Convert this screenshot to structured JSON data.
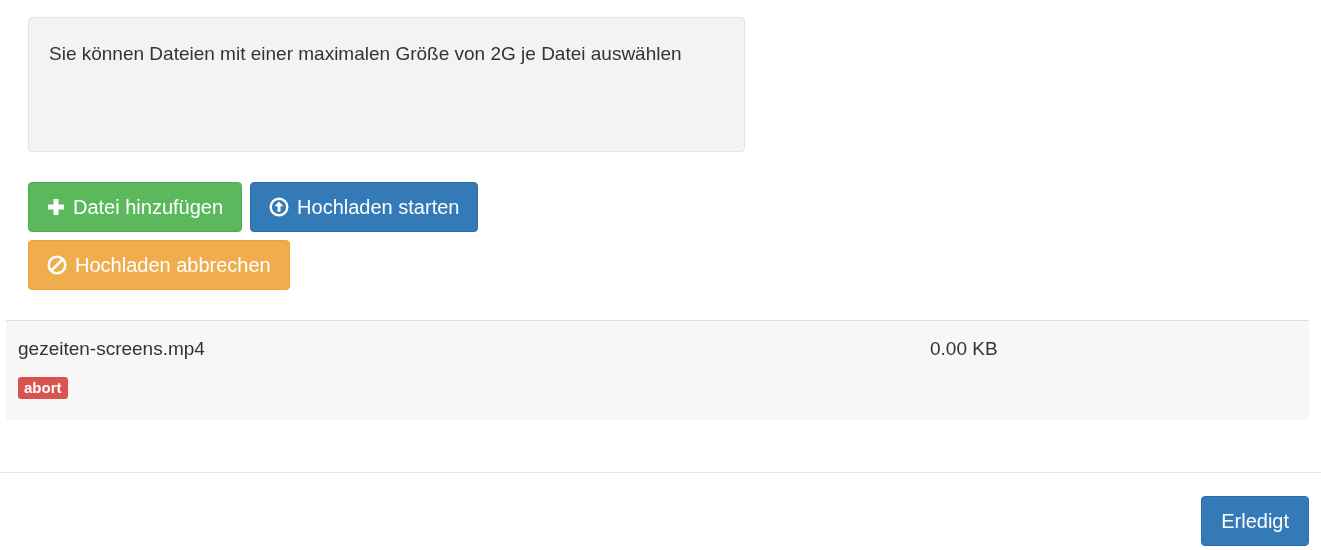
{
  "info": {
    "text": "Sie können Dateien mit einer maximalen Größe von 2G je Datei auswählen"
  },
  "actions": [
    {
      "kind": "add",
      "label": "Datei hinzufügen"
    },
    {
      "kind": "start",
      "label": "Hochladen starten"
    },
    {
      "kind": "cancel",
      "label": "Hochladen abbrechen"
    }
  ],
  "files": [
    {
      "name": "gezeiten-screens.mp4",
      "size": "0.00 KB",
      "status": "abort"
    }
  ],
  "footer": {
    "button": "Erledigt"
  }
}
